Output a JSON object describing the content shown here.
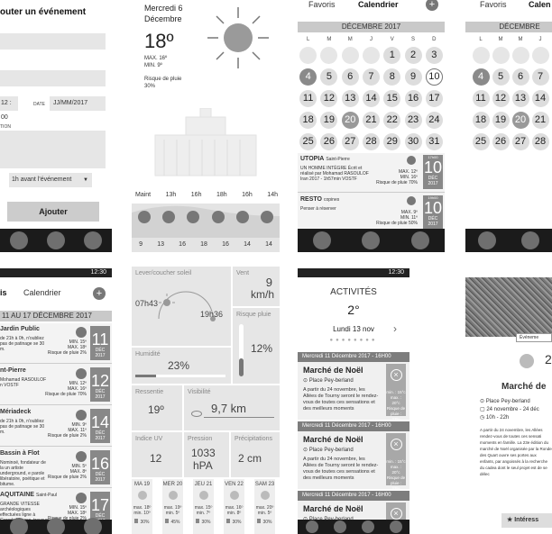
{
  "add_event": {
    "title": "outer un événement",
    "time_value": "12 : 00",
    "date_label": "DATE",
    "date_placeholder": "JJ/MM/2017",
    "desc_label": "TION",
    "reminder": "1h avant l'événement",
    "submit": "Ajouter"
  },
  "weather": {
    "day": "Mercredi 6",
    "month": "Décembre",
    "temp": "18º",
    "max": "MAX. 16º",
    "min": "MIN. 9º",
    "rain": "Risque de pluie 30%",
    "hours_label": "Maint",
    "hours": [
      "13h",
      "16h",
      "18h",
      "16h",
      "14h"
    ],
    "temps": [
      "9",
      "13",
      "16",
      "18",
      "16",
      "14",
      "14"
    ]
  },
  "calendar_full": {
    "tab_favoris": "Favoris",
    "tab_calendrier": "Calendrier",
    "add_icon": "plus-icon",
    "month": "DÉCEMBRE 2017",
    "dow": [
      "L",
      "M",
      "M",
      "J",
      "V",
      "S",
      "D"
    ],
    "days": [
      "",
      "",
      "",
      "",
      "1",
      "2",
      "3",
      "4",
      "5",
      "6",
      "7",
      "8",
      "9",
      "10",
      "11",
      "12",
      "13",
      "14",
      "15",
      "16",
      "17",
      "18",
      "19",
      "20",
      "21",
      "22",
      "23",
      "24",
      "25",
      "26",
      "27",
      "28",
      "29",
      "30",
      "31"
    ],
    "events": [
      {
        "title": "UTOPIA",
        "sub": "Saint-Pierre",
        "desc": "UN HOMME INTÈGRE Écrit et réalisé par Mohamad RASOULOF Iran 2017 - 1h57min VOSTF",
        "max": "MAX. 12º",
        "min": "MIN. 16º",
        "rain": "Risque de pluie 70%",
        "day": "10",
        "month": "DÉC 2017",
        "time": "17h00"
      },
      {
        "title": "RESTO",
        "sub": "copines",
        "desc": "Penser à réserver",
        "max": "MAX. 9º",
        "min": "MIN. 11º",
        "rain": "Risque de pluie 50%",
        "day": "10",
        "month": "DÉC 2017",
        "time": "19h00"
      }
    ]
  },
  "calendar_partial": {
    "tab_favoris": "Favoris",
    "tab_calendrier": "Calen",
    "month": "DÉCEMBRE",
    "dow": [
      "L",
      "M",
      "M",
      "J"
    ],
    "rows": [
      [
        "",
        "",
        "",
        ""
      ],
      [
        "4",
        "5",
        "6",
        "7"
      ],
      [
        "11",
        "12",
        "13",
        "14"
      ],
      [
        "18",
        "19",
        "20",
        "21"
      ],
      [
        "25",
        "26",
        "27",
        "28"
      ]
    ]
  },
  "week_list": {
    "tab_main": "is",
    "tab_cal": "Calendrier",
    "status": "12:30",
    "range": "11 AU 17 DÉCEMBRE 2017",
    "items": [
      {
        "title": "Jardin Public",
        "desc": "de 21h à 0h, n'oubliez pas de patinage se 30 m.",
        "max": "MIN. 15º",
        "min": "MAX. 18º",
        "rain": "Risque de pluie 2%",
        "day": "11",
        "month": "DÉC 2017"
      },
      {
        "title": "nt-Pierre",
        "desc": "Mohamad RASOULOF n VOSTF",
        "max": "MIN. 12º",
        "min": "MAX. 16º",
        "rain": "Risque de pluie 70%",
        "day": "12",
        "month": "DÉC 2017"
      },
      {
        "title": "Mériadeck",
        "desc": "de 21h à 0h, n'oubliez pas de patinage se 30 m.",
        "max": "MIN. 9º",
        "min": "MAX. 11º",
        "rain": "Risque de pluie 2%",
        "day": "14",
        "month": "DÉC 2017"
      },
      {
        "title": "Bassin à Flot",
        "desc": "Nominoë, fondateur de la un artiste underground, e parole libératoire, poétique et bitume.",
        "max": "MIN. 5º",
        "min": "MAX. 8º",
        "rain": "Risque de pluie 2%",
        "day": "16",
        "month": "DÉC 2017"
      },
      {
        "title": "AQUITAINE",
        "sub": "Saint-Paul",
        "desc": "GRANDE VITESSE archéologiques effectuées ligne à Grande Vitesse, travaux les 50 sites",
        "max": "MIN. 15º",
        "min": "MAX. 18º",
        "rain": "Risque de pluie 2%",
        "day": "17",
        "month": "DÉC 2017"
      }
    ]
  },
  "details": {
    "sun_label": "Lever/coucher soleil",
    "sunrise": "07h43",
    "sunset": "19h36",
    "wind_label": "Vent",
    "wind_value": "9",
    "wind_unit": "km/h",
    "humidity_label": "Humidité",
    "humidity": "23%",
    "humidity_fill": 0.23,
    "rain_label": "Risque pluie",
    "rain": "12%",
    "rain_fill": 0.12,
    "feel_label": "Ressentie",
    "feel": "19º",
    "vis_label": "Visibilité",
    "vis": "9,7 km",
    "uv_label": "Indice UV",
    "uv": "12",
    "pressure_label": "Pression",
    "pressure_value": "1033",
    "pressure_unit": "hPA",
    "precip_label": "Précipitations",
    "precip": "2 cm",
    "forecast": [
      {
        "day": "MA 19",
        "max": "max. 18º",
        "min": "min. 10º",
        "rain": "30%"
      },
      {
        "day": "MER 20",
        "max": "max. 19º",
        "min": "min. 5º",
        "rain": "45%"
      },
      {
        "day": "JEU 21",
        "max": "max. 15º",
        "min": "min. 7º",
        "rain": "30%"
      },
      {
        "day": "VEN 22",
        "max": "max. 16º",
        "min": "min. 8º",
        "rain": "30%"
      },
      {
        "day": "SAM 23",
        "max": "max. 20º",
        "min": "min. 5º",
        "rain": "30%"
      }
    ]
  },
  "activities": {
    "title": "ACTIVITÉS",
    "temp": "2°",
    "date": "Lundi 13 nov",
    "status": "12:30",
    "items": [
      {
        "header": "Mercredi 11 Décembre  2017 - 16H00",
        "title": "Marché de Noël",
        "place": "Place Pey-berland",
        "text": "A partir du 24 novembre, les Allées de Tourny seront le rendez-vous de toutes ces sensations et des meilleurs moments",
        "mm": "min. : 15°c max. : 20°c Risque de pluie : 23%"
      },
      {
        "header": "Mercredi 11 Décembre  2017 - 16H00",
        "title": "Marché de Noël",
        "place": "Place Pey-berland",
        "text": "A partir du 24 novembre, les Allées de Tourny seront le rendez-vous de toutes ces sensations et des meilleurs moments",
        "mm": "min. : 15°c max. : 20°c Risque de pluie : 23%"
      },
      {
        "header": "Mercredi 11 Décembre  2017 - 16H00",
        "title": "Marché de Noël",
        "place": "Place Pey-berland",
        "text": "A partir du 24 novembre, les Allées de Tourny seront le rendez-vous de toutes",
        "mm": "min. : 15°c"
      }
    ]
  },
  "event_detail": {
    "tag": "Événeme",
    "number": "2",
    "title": "Marché de",
    "place": "Place Pey-berland",
    "dates": "24 novembre - 24 déc",
    "hours": "10h - 22h",
    "body": "A partir du 24 novembre, les Allées rendez-vous de toutes ces sensati moments en famille. La 23e édition du marché de Noël organisée par la Ronde des Quart ouvre ses portes aux enfants, par angoissés à la recherche du cadea dont le seul projet est de se délec",
    "button": "Intéress"
  }
}
